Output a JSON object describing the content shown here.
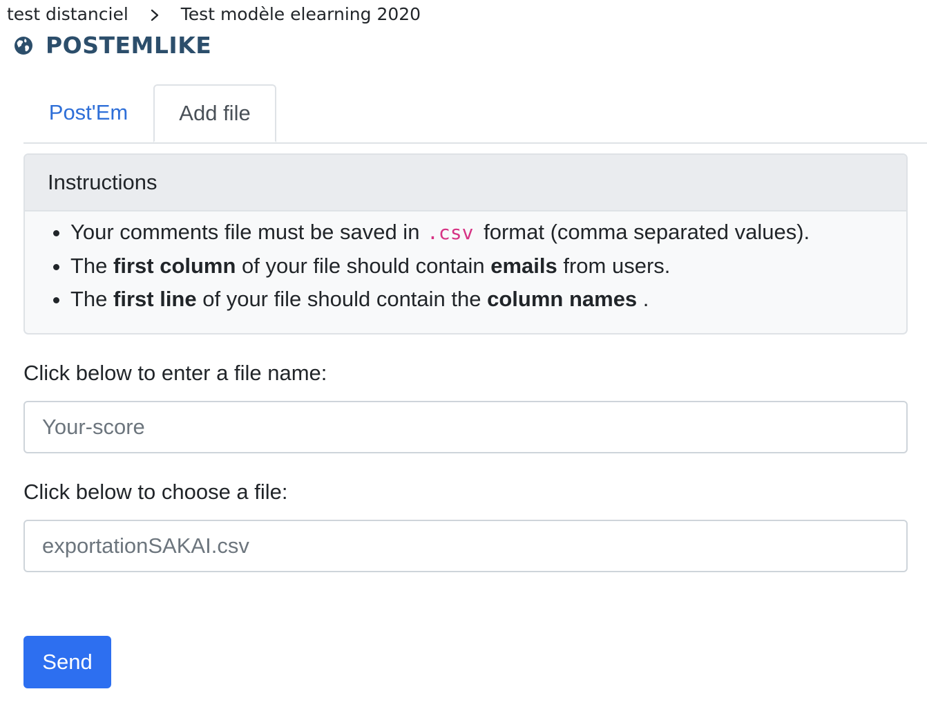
{
  "breadcrumb": {
    "items": [
      "test distanciel",
      "Test modèle elearning 2020"
    ]
  },
  "tool": {
    "title": "POSTEMLIKE",
    "icon": "globe-icon",
    "title_color": "#2c4e6b"
  },
  "tabs": [
    {
      "label": "Post'Em",
      "active": false
    },
    {
      "label": "Add file",
      "active": true
    }
  ],
  "instructions": {
    "header": "Instructions",
    "items": [
      {
        "parts": [
          "Your comments file must be saved in ",
          ".csv",
          " format (comma separated values)."
        ]
      },
      {
        "parts": [
          "The ",
          "first column",
          " of your file should contain ",
          "emails",
          " from users."
        ]
      },
      {
        "parts": [
          "The ",
          "first line",
          " of your file should contain the ",
          "column names",
          " ."
        ]
      }
    ]
  },
  "form": {
    "name_label": "Click below to enter a file name:",
    "name_placeholder": "Your-score",
    "name_value": "",
    "file_label": "Click below to choose a file:",
    "file_value": "exportationSAKAI.csv",
    "send_label": "Send"
  },
  "colors": {
    "link": "#2e6fd8",
    "primary_button": "#2d6ff0",
    "code": "#d63384"
  }
}
